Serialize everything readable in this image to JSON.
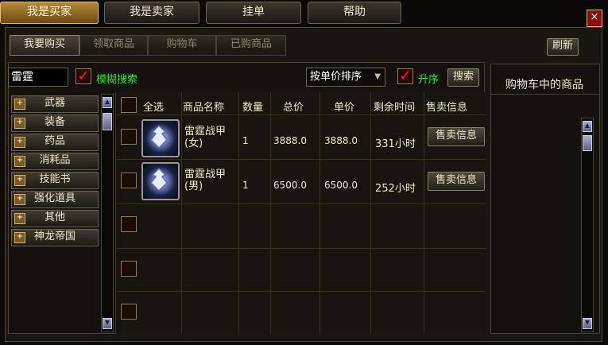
{
  "top_tabs": [
    {
      "label": "我是买家"
    },
    {
      "label": "我是卖家"
    },
    {
      "label": "挂单"
    },
    {
      "label": "帮助"
    }
  ],
  "close_icon": "×",
  "sub_tabs": [
    {
      "label": "我要购买"
    },
    {
      "label": "领取商品"
    },
    {
      "label": "购物车"
    },
    {
      "label": "已购商品"
    }
  ],
  "refresh_label": "刷新",
  "search": {
    "value": "雷霆",
    "fuzzy_label": "模糊搜索",
    "sort_value": "按单价排序",
    "asc_label": "升序",
    "search_button": "搜索"
  },
  "categories": [
    "武器",
    "装备",
    "药品",
    "消耗品",
    "技能书",
    "强化道具",
    "其他",
    "神龙帝国"
  ],
  "table": {
    "select_all": "全选",
    "headers": [
      "商品名称",
      "数量",
      "总价",
      "单价",
      "剩余时间",
      "售卖信息"
    ],
    "rows": [
      {
        "name": "雷霆战甲(女)",
        "name_line1": "雷霆战甲",
        "name_line2": "(女)",
        "qty": "1",
        "total": "3888.0",
        "unit": "3888.0",
        "time": "331小时",
        "info_button": "售卖信息"
      },
      {
        "name": "雷霆战甲(男)",
        "name_line1": "雷霆战甲",
        "name_line2": "(男)",
        "qty": "1",
        "total": "6500.0",
        "unit": "6500.0",
        "time": "252小时",
        "info_button": "售卖信息"
      }
    ]
  },
  "cart_title": "购物车中的商品",
  "colors": {
    "accent_green": "#38e038",
    "check_red": "#ff2020",
    "active_tab": "#b48a3a"
  }
}
